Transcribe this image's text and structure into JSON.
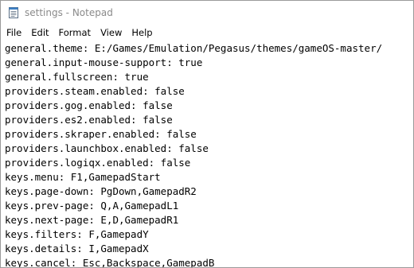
{
  "window": {
    "title": "settings - Notepad",
    "app_icon": "notepad-icon"
  },
  "menu": {
    "items": [
      "File",
      "Edit",
      "Format",
      "View",
      "Help"
    ]
  },
  "editor": {
    "lines": [
      "general.theme: E:/Games/Emulation/Pegasus/themes/gameOS-master/",
      "general.input-mouse-support: true",
      "general.fullscreen: true",
      "providers.steam.enabled: false",
      "providers.gog.enabled: false",
      "providers.es2.enabled: false",
      "providers.skraper.enabled: false",
      "providers.launchbox.enabled: false",
      "providers.logiqx.enabled: false",
      "keys.menu: F1,GamepadStart",
      "keys.page-down: PgDown,GamepadR2",
      "keys.prev-page: Q,A,GamepadL1",
      "keys.next-page: E,D,GamepadR1",
      "keys.filters: F,GamepadY",
      "keys.details: I,GamepadX",
      "keys.cancel: Esc,Backspace,GamepadB"
    ]
  }
}
